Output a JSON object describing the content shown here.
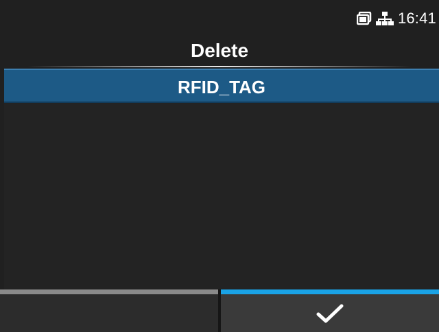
{
  "status_bar": {
    "time": "16:41",
    "icons": [
      "card-icon",
      "network-icon"
    ]
  },
  "header": {
    "title": "Delete"
  },
  "list": {
    "items": [
      {
        "label": "RFID_TAG",
        "selected": true
      }
    ]
  },
  "softkeys": {
    "left": {
      "label": "",
      "icon": ""
    },
    "right": {
      "label": "",
      "icon": "check-icon"
    }
  },
  "colors": {
    "background": "#202020",
    "selection": "#1d5a86",
    "confirm_accent": "#1aa3e6",
    "inactive_accent": "#8a8a8a"
  }
}
